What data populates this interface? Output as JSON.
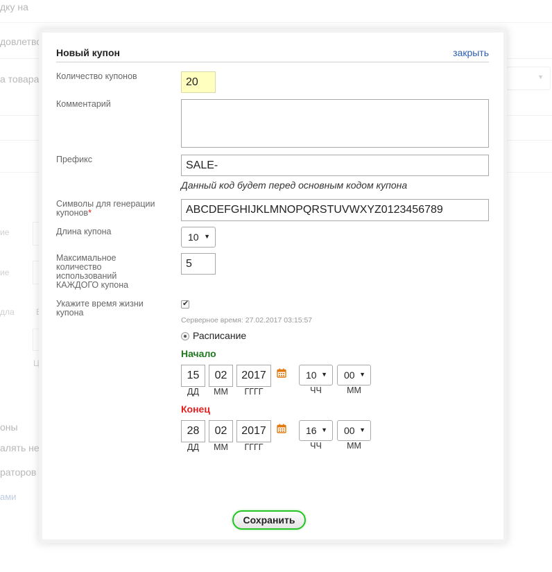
{
  "background": {
    "texts": [
      "дку на",
      "довлетво",
      "а товара",
      "ие",
      "ие",
      "дла",
      "Е",
      "Ц",
      "оны",
      "алять не",
      "раторов",
      "ами"
    ]
  },
  "modal": {
    "title": "Новый купон",
    "close_label": "закрыть",
    "fields": {
      "count": {
        "label": "Количество купонов",
        "value": "20"
      },
      "comment": {
        "label": "Комментарий",
        "value": ""
      },
      "prefix": {
        "label": "Префикс",
        "value": "SALE-",
        "hint": "Данный код будет перед основным кодом купона"
      },
      "symbols": {
        "label": "Символы для генерации купонов",
        "required_mark": "*",
        "value": "ABCDEFGHIJKLMNOPQRSTUVWXYZ0123456789"
      },
      "length": {
        "label": "Длина купона",
        "value": "10"
      },
      "max_uses": {
        "label_lines": [
          "Максимальное",
          "количество",
          "использований",
          "КАЖДОГО купона"
        ],
        "value": "5"
      },
      "lifetime": {
        "label": "Укажите время жизни купона",
        "checked": true
      }
    },
    "server_time": "Серверное время: 27.02.2017 03:15:57",
    "schedule_label": "Расписание",
    "start": {
      "title": "Начало",
      "day": "15",
      "month": "02",
      "year": "2017",
      "hour": "10",
      "minute": "00"
    },
    "end": {
      "title": "Конец",
      "day": "28",
      "month": "02",
      "year": "2017",
      "hour": "16",
      "minute": "00"
    },
    "units": {
      "day": "ДД",
      "month": "ММ",
      "year": "ГГГГ",
      "hour": "ЧЧ",
      "minute": "ММ"
    },
    "save_label": "Сохранить"
  },
  "colors": {
    "link": "#2a5db0",
    "start_title": "#1f7a1f",
    "end_title": "#e02020",
    "save_border": "#22c422",
    "highlight_input": "#ffffc0",
    "calendar_icon": "#e07a10"
  },
  "icons": [
    "calendar-icon",
    "dropdown-arrow-icon",
    "checkbox-check-icon"
  ]
}
